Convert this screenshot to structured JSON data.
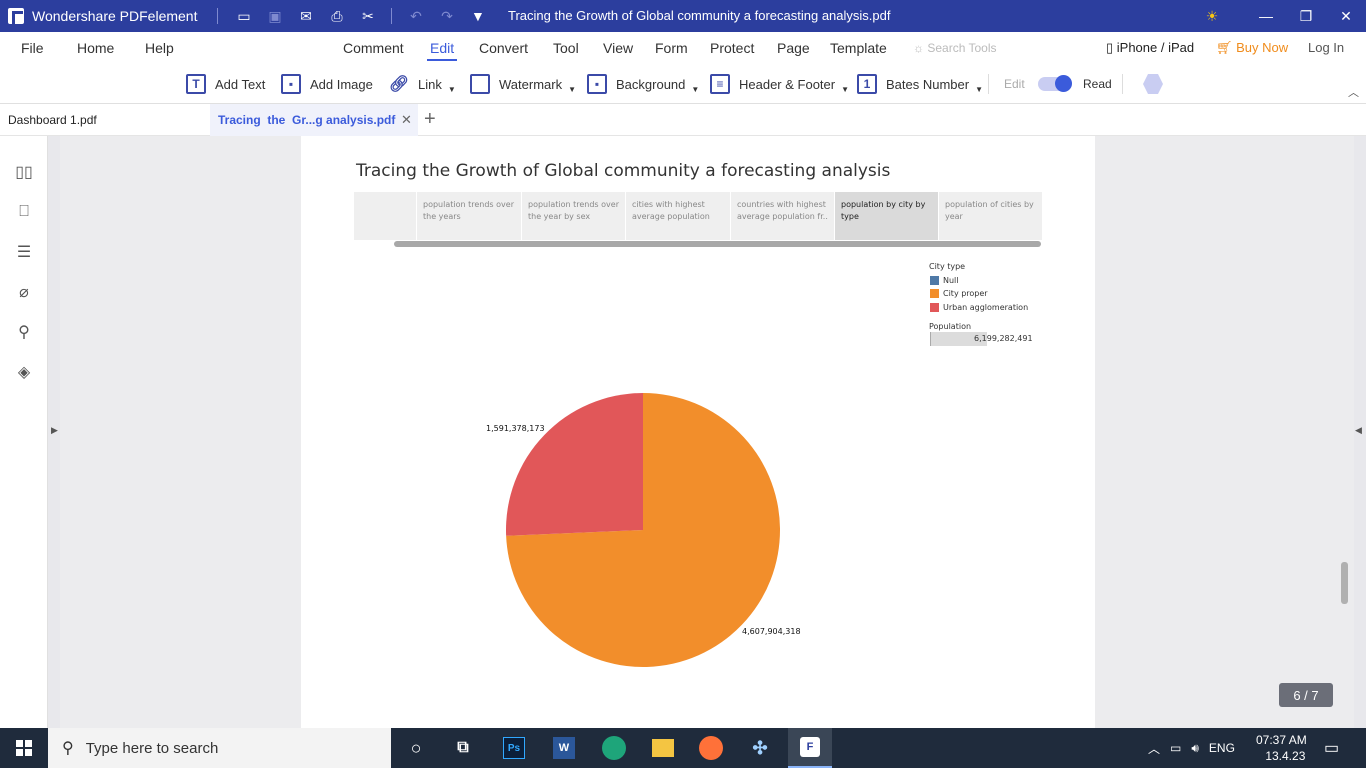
{
  "app": {
    "name": "Wondershare PDFelement",
    "document_title": "Tracing the Growth of Global community a forecasting analysis.pdf"
  },
  "menu": {
    "items": [
      "File",
      "Home",
      "Help",
      "Comment",
      "Edit",
      "Convert",
      "Tool",
      "View",
      "Form",
      "Protect",
      "Page",
      "Template"
    ],
    "active": "Edit",
    "search_placeholder": "Search Tools",
    "device": "iPhone / iPad",
    "buy_now": "Buy Now",
    "login": "Log In"
  },
  "toolbar": {
    "add_text": "Add Text",
    "add_image": "Add Image",
    "link": "Link",
    "watermark": "Watermark",
    "background": "Background",
    "header_footer": "Header & Footer",
    "bates_number": "Bates Number",
    "edit_label": "Edit",
    "read_label": "Read"
  },
  "tabs": {
    "tab1": "Dashboard 1.pdf",
    "tab2": "Tracing  the  Gr...g analysis.pdf"
  },
  "pdf": {
    "title": "Tracing the Growth of Global community a forecasting analysis",
    "dashboard_tabs": [
      "population trends over the years",
      "population trends over the year by sex",
      "cities with highest average population",
      "countries with highest average population fr..",
      "population by city by type",
      "population of cities by year"
    ],
    "selected_tab": "population by city by type",
    "legend_title": "City type",
    "legend_items": [
      {
        "label": "Null",
        "color": "#4e79a7"
      },
      {
        "label": "City proper",
        "color": "#f28e2b"
      },
      {
        "label": "Urban agglomeration",
        "color": "#e15759"
      }
    ],
    "size_legend_title": "Population",
    "size_legend_value": "6,199,282,491"
  },
  "chart_data": {
    "type": "pie",
    "categories": [
      "City proper",
      "Urban agglomeration"
    ],
    "values": [
      4607904318,
      1591378173
    ],
    "value_labels": [
      "4,607,904,318",
      "1,591,378,173"
    ],
    "colors": [
      "#f28e2b",
      "#e15759"
    ]
  },
  "page_indicator": "6 / 7",
  "taskbar": {
    "search_placeholder": "Type here to search",
    "language": "ENG",
    "time": "07:37 AM",
    "date": "13.4.23"
  }
}
